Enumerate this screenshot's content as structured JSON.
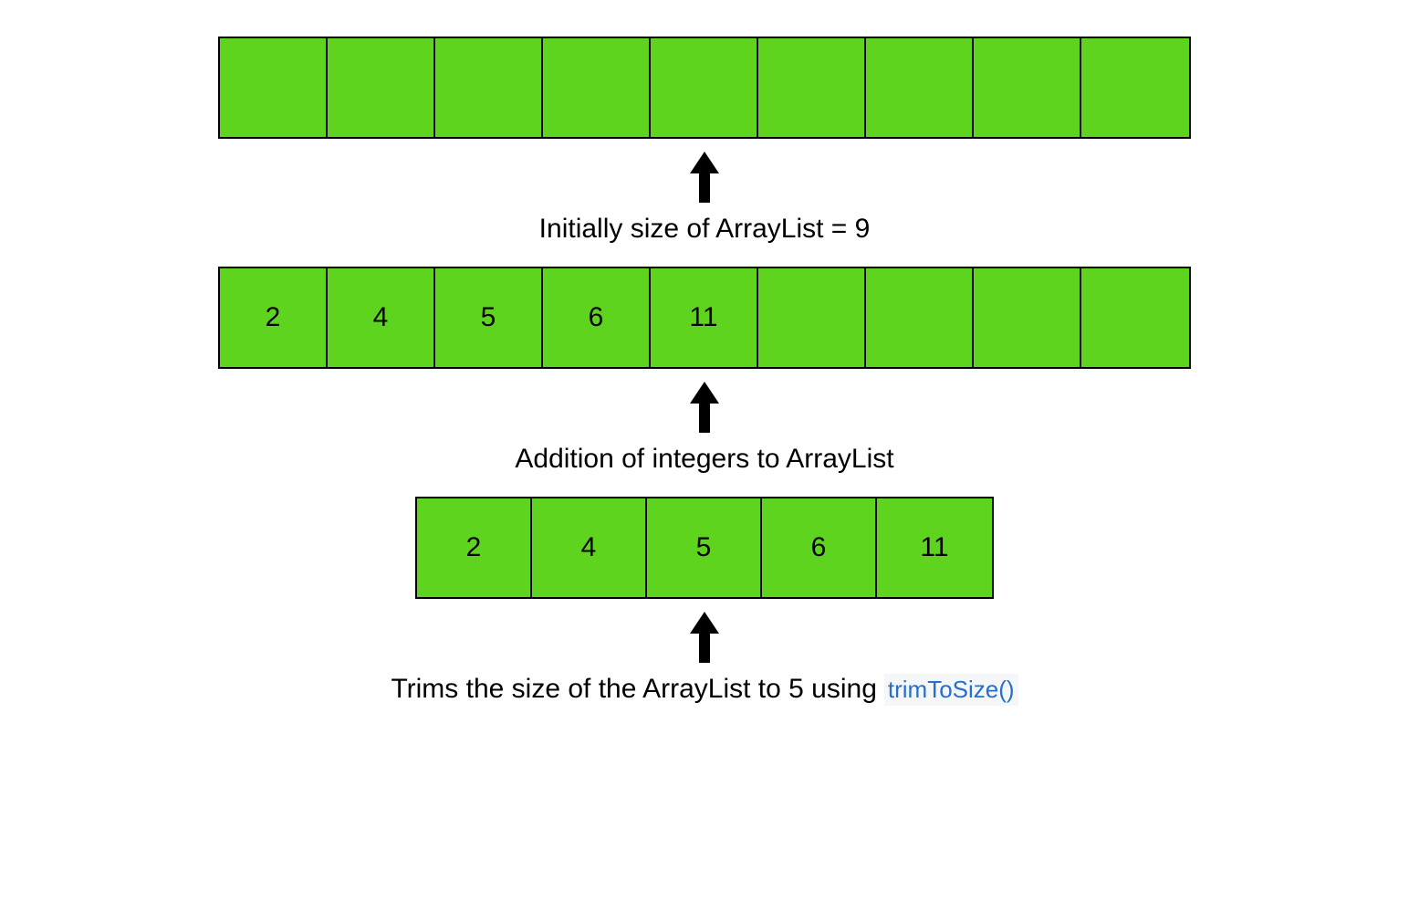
{
  "rows": [
    {
      "capacity": 9,
      "values": [
        "",
        "",
        "",
        "",
        "",
        "",
        "",
        "",
        ""
      ]
    },
    {
      "capacity": 9,
      "values": [
        "2",
        "4",
        "5",
        "6",
        "11",
        "",
        "",
        "",
        ""
      ]
    },
    {
      "capacity": 5,
      "values": [
        "2",
        "4",
        "5",
        "6",
        "11"
      ]
    }
  ],
  "captions": {
    "initial": "Initially size of ArrayList = 9",
    "addition": "Addition of integers to ArrayList",
    "trim_prefix": "Trims the size of the ArrayList to 5 using",
    "trim_method": "trimToSize()"
  },
  "colors": {
    "cell_bg": "#5fd41f",
    "link": "#2670c9"
  }
}
